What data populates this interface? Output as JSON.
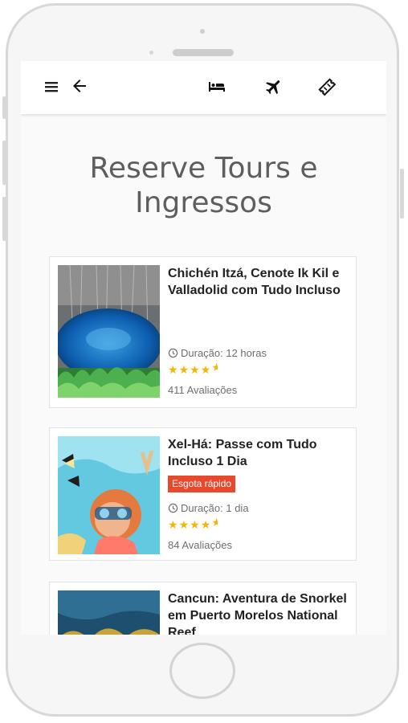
{
  "header": {
    "menu_icon": "hamburger-menu-icon",
    "back_icon": "arrow-left-icon",
    "tabs": [
      {
        "icon": "bed-hotel-icon"
      },
      {
        "icon": "airplane-flight-icon"
      },
      {
        "icon": "ticket-icon"
      }
    ]
  },
  "page": {
    "title": "Reserve Tours e Ingressos"
  },
  "colors": {
    "accent_star": "#f2b705",
    "badge": "#e8482c",
    "title_text": "#5e5e5e"
  },
  "tours": [
    {
      "title": "Chichén Itzá, Cenote Ik Kil e Valladolid com Tudo Incluso",
      "badge": "",
      "duration": "Duração: 12 horas",
      "rating": 4.5,
      "reviews": "411 Avaliações"
    },
    {
      "title": "Xel-Há: Passe com Tudo Incluso 1 Dia",
      "badge": "Esgota rápido",
      "duration": "Duração: 1 dia",
      "rating": 4.5,
      "reviews": "84 Avaliações"
    },
    {
      "title": "Cancun: Aventura de Snorkel em Puerto Morelos National Reef",
      "badge": "",
      "duration": "",
      "rating": null,
      "reviews": ""
    }
  ]
}
